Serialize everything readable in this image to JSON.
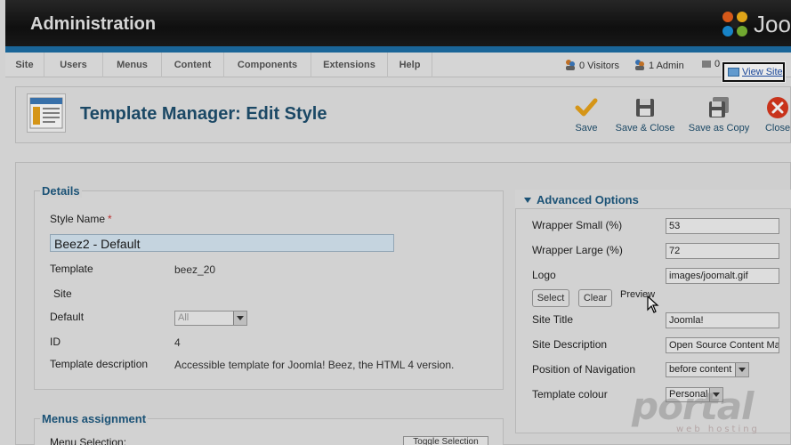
{
  "header": {
    "title": "Administration",
    "logo_text": "Joo"
  },
  "menu": [
    {
      "label": "Site"
    },
    {
      "label": "Users"
    },
    {
      "label": "Menus"
    },
    {
      "label": "Content"
    },
    {
      "label": "Components"
    },
    {
      "label": "Extensions"
    },
    {
      "label": "Help"
    }
  ],
  "status": {
    "visitors": "0 Visitors",
    "admins": "1 Admin",
    "messages": "0"
  },
  "view_site": {
    "label": "View Site"
  },
  "toolbar": {
    "title": "Template Manager: Edit Style",
    "buttons": [
      {
        "label": "Save",
        "icon": "check-icon",
        "color": "#e8a21a"
      },
      {
        "label": "Save & Close",
        "icon": "save-disk-icon",
        "color": "#555555"
      },
      {
        "label": "Save as Copy",
        "icon": "copy-disk-icon",
        "color": "#555555"
      },
      {
        "label": "Close",
        "icon": "close-circle-icon",
        "color": "#d9381e"
      }
    ]
  },
  "details": {
    "legend": "Details",
    "style_name_label": "Style Name",
    "required_mark": "*",
    "style_name_value": "Beez2 - Default",
    "template_label": "Template",
    "template_value": "beez_20",
    "site_label": "Site",
    "default_label": "Default",
    "default_value": "All",
    "id_label": "ID",
    "id_value": "4",
    "description_label": "Template description",
    "description_value": "Accessible template for Joomla! Beez, the HTML 4 version."
  },
  "menus_assignment": {
    "legend": "Menus assignment",
    "menu_selection_label": "Menu Selection:",
    "toggle_label": "Toggle Selection"
  },
  "advanced": {
    "title": "Advanced Options",
    "wrapper_small_label": "Wrapper Small (%)",
    "wrapper_small_value": "53",
    "wrapper_large_label": "Wrapper Large (%)",
    "wrapper_large_value": "72",
    "logo_label": "Logo",
    "logo_value": "images/joomalt.gif",
    "select_label": "Select",
    "clear_label": "Clear",
    "preview_label": "Preview",
    "site_title_label": "Site Title",
    "site_title_value": "Joomla!",
    "site_description_label": "Site Description",
    "site_description_value": "Open Source Content Man",
    "nav_position_label": "Position of Navigation",
    "nav_position_value": "before content",
    "template_colour_label": "Template colour",
    "template_colour_value": "Personal"
  },
  "watermark": {
    "main": "portal",
    "sub": "web hosting"
  },
  "colors": {
    "accent": "#1d6ea5",
    "title": "#1e4f6e",
    "legend": "#1e5a80"
  }
}
